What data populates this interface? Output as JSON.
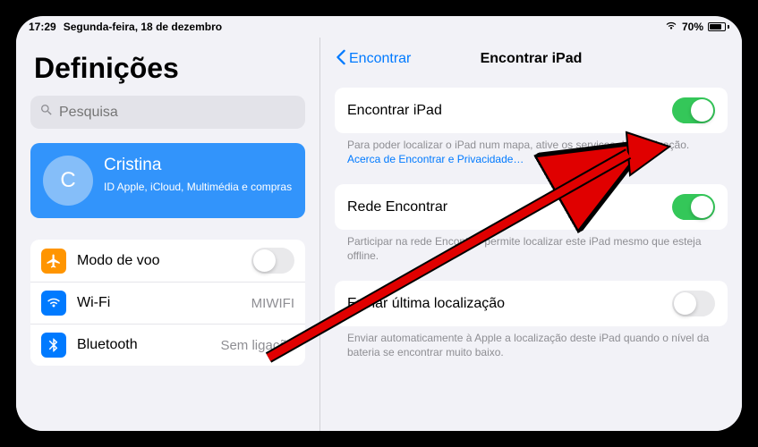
{
  "status": {
    "time": "17:29",
    "date": "Segunda-feira, 18 de dezembro",
    "battery_percent": "70%"
  },
  "sidebar": {
    "title": "Definições",
    "search_placeholder": "Pesquisa",
    "profile": {
      "initial": "C",
      "name": "Cristina",
      "subtitle": "ID Apple, iCloud, Multimédia e compras"
    },
    "rows": {
      "airplane": {
        "label": "Modo de voo"
      },
      "wifi": {
        "label": "Wi-Fi",
        "value": "MIWIFI"
      },
      "bluetooth": {
        "label": "Bluetooth",
        "value": "Sem ligação"
      }
    }
  },
  "detail": {
    "back_label": "Encontrar",
    "title": "Encontrar iPad",
    "groups": [
      {
        "label": "Encontrar iPad",
        "desc_prefix": "Para poder localizar o iPad num mapa, ative os serviços de localização. ",
        "desc_link": "Acerca de Encontrar e Privacidade…",
        "toggle_on": true
      },
      {
        "label": "Rede Encontrar",
        "desc": "Participar na rede Encontrar permite localizar este iPad mesmo que esteja offline.",
        "toggle_on": true
      },
      {
        "label": "Enviar última localização",
        "desc": "Enviar automaticamente à Apple a localização deste iPad quando o nível da bateria se encontrar muito baixo.",
        "toggle_on": false
      }
    ]
  }
}
